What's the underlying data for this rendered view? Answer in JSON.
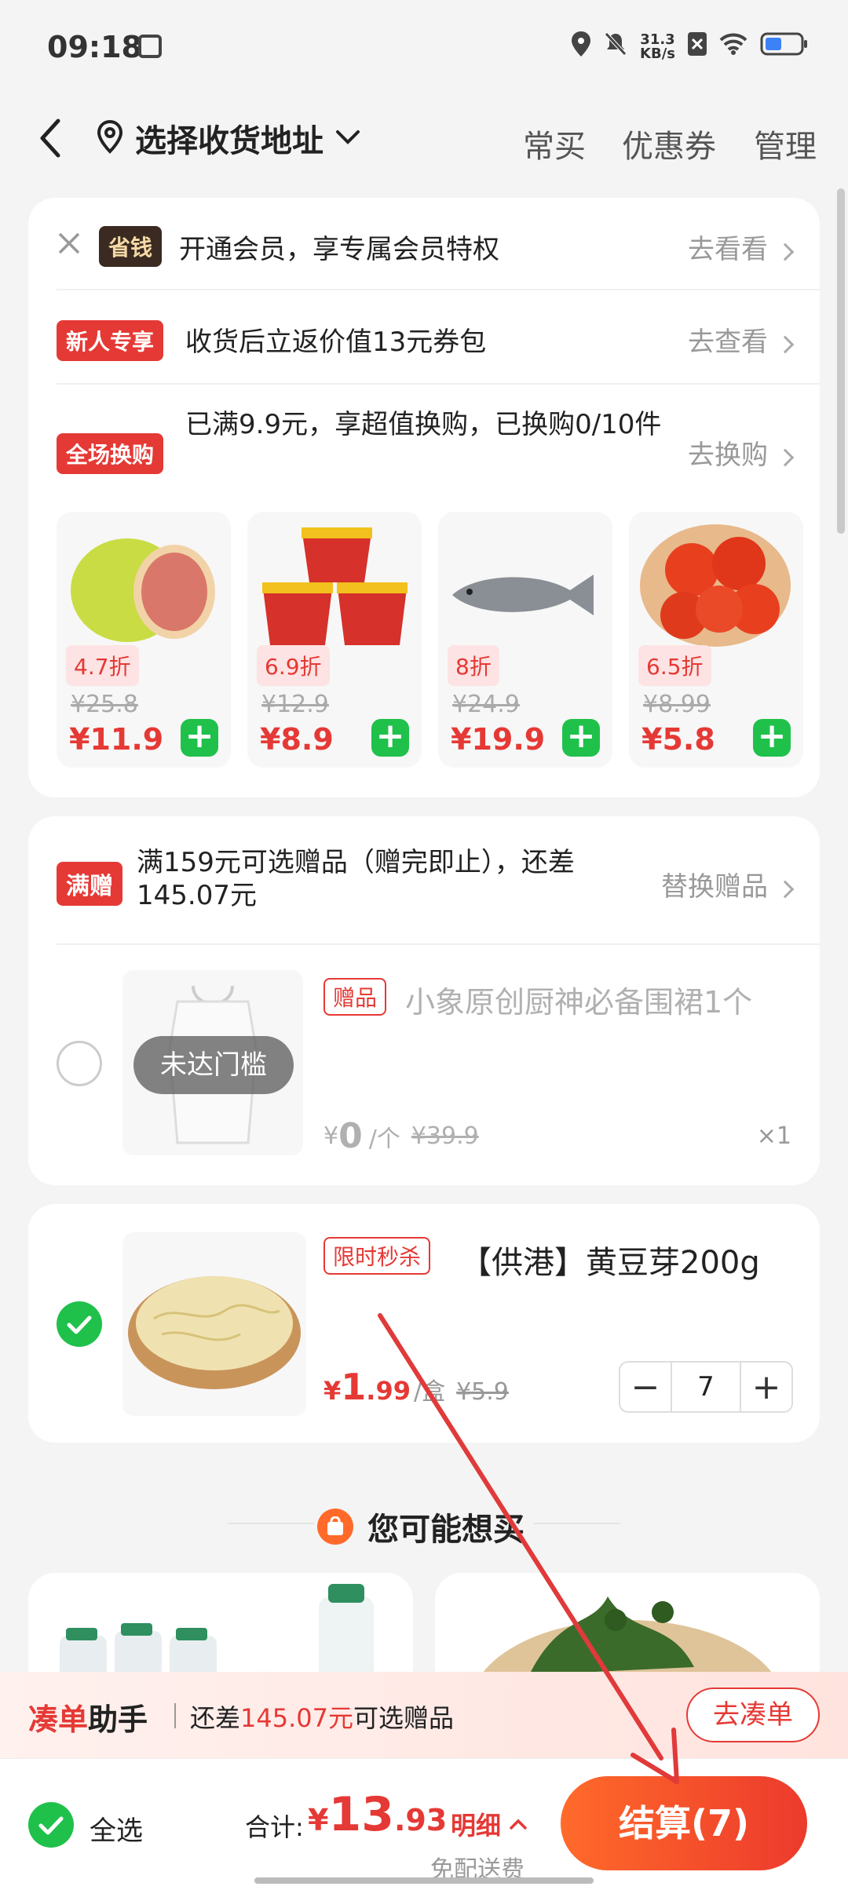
{
  "status": {
    "time": "09:18",
    "speed_top": "31.3",
    "speed_bottom": "KB/s"
  },
  "nav": {
    "back": "‹",
    "address": "选择收货地址",
    "actions": [
      "常买",
      "优惠券",
      "管理"
    ]
  },
  "promo": {
    "rows": [
      {
        "tag": "省钱",
        "text": "开通会员，享专属会员特权",
        "link": "去看看"
      },
      {
        "tag": "新人专享",
        "text": "收货后立返价值13元券包",
        "link": "去查看"
      },
      {
        "tag": "全场换购",
        "text": "已满9.9元，享超值换购，已换购0/10件",
        "link": "去换购"
      }
    ],
    "products": [
      {
        "discount": "4.7折",
        "orig": "¥25.8",
        "price": "¥11.9"
      },
      {
        "discount": "6.9折",
        "orig": "¥12.9",
        "price": "¥8.9"
      },
      {
        "discount": "8折",
        "orig": "¥24.9",
        "price": "¥19.9"
      },
      {
        "discount": "6.5折",
        "orig": "¥8.99",
        "price": "¥5.8"
      }
    ]
  },
  "gift": {
    "tag": "满赠",
    "text": "满159元可选赠品（赠完即止），还差145.07元",
    "link": "替换赠品",
    "overlay": "未达门槛",
    "item_tag": "赠品",
    "item_name": "小象原创厨神必备围裙1个",
    "price_sym": "¥",
    "price": "0",
    "unit": "/个",
    "orig": "¥39.9",
    "qty": "×1"
  },
  "cart_item": {
    "tag": "限时秒杀",
    "name": "【供港】黄豆芽200g",
    "price_sym": "¥",
    "price_int": "1",
    "price_dec": ".99",
    "unit": "/盒",
    "orig": "¥5.9",
    "qty": "7"
  },
  "recommend": {
    "title": "您可能想买"
  },
  "helper": {
    "title_a": "凑单",
    "title_b": "助手",
    "pre": "还差",
    "amount": "145.07元",
    "post": "可选赠品",
    "button": "去凑单"
  },
  "footer": {
    "select_all": "全选",
    "total_label": "合计:",
    "sym": "¥",
    "total_int": "13",
    "total_dec": ".93",
    "detail": "明细",
    "free_ship": "免配送费",
    "checkout": "结算(7)"
  },
  "colors": {
    "accent": "#e53935",
    "green": "#1fc14b",
    "orange_start": "#ff6a2a",
    "orange_end": "#ec3a2c"
  }
}
